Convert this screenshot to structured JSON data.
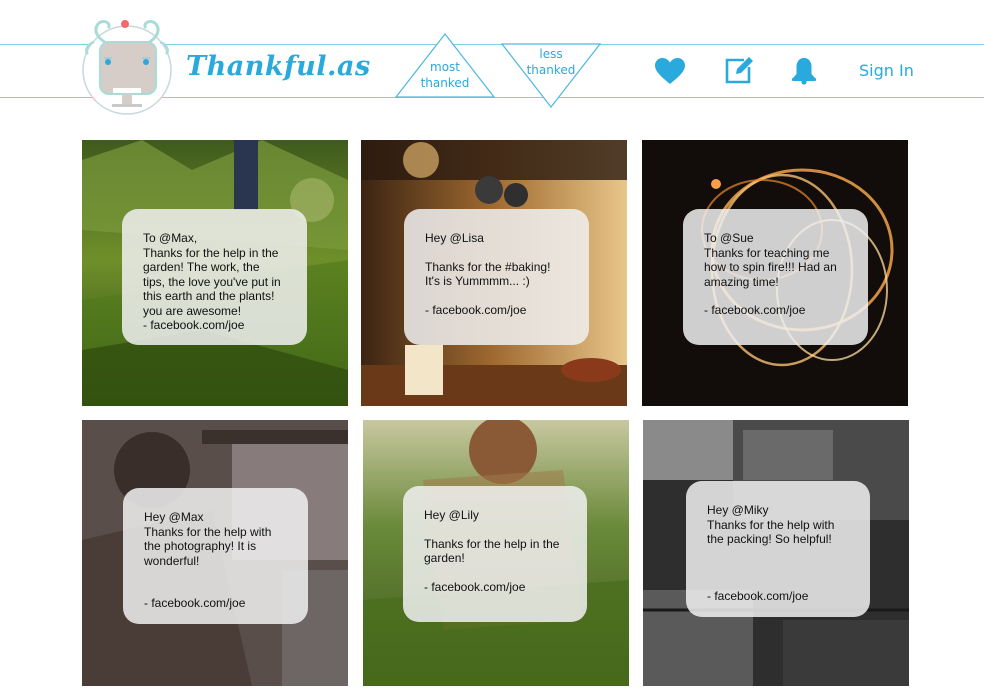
{
  "header": {
    "brand": "Thankful.as",
    "tabs": [
      {
        "line1": "most",
        "line2": "thanked"
      },
      {
        "line1": "less",
        "line2": "thanked"
      }
    ],
    "icons": [
      "heart-icon",
      "edit-icon",
      "bell-icon"
    ],
    "sign_in": "Sign In"
  },
  "colors": {
    "accent": "#29a9dc",
    "card": "#f0f0f0"
  },
  "posts": [
    {
      "to": "To @Max,",
      "lines": [
        "Thanks for the help in the",
        "garden! The work, the",
        "tips, the love you've put in",
        "this earth and the plants!",
        "you are awesome!"
      ],
      "from": "- facebook.com/joe",
      "photo": "green grass with person standing"
    },
    {
      "to": "Hey @Lisa",
      "lines": [
        "Thanks for the #baking!",
        "It's is Yummmm... :)"
      ],
      "from": "- facebook.com/joe",
      "photo": "warm kitchen with hanging pans"
    },
    {
      "to": "To @Sue",
      "lines": [
        "Thanks for teaching me",
        "how to spin fire!!! Had an",
        "amazing time!"
      ],
      "from": "- facebook.com/joe",
      "photo": "fire spinning circles at night"
    },
    {
      "to": "Hey @Max",
      "lines": [
        "Thanks for the help with",
        "the photography! It is",
        "wonderful!"
      ],
      "from": "- facebook.com/joe",
      "photo": "black and white portrait of man"
    },
    {
      "to": "Hey @Lily",
      "lines": [
        "Thanks for the help in the",
        "garden!"
      ],
      "from": "- facebook.com/joe",
      "photo": "person gardening in grass"
    },
    {
      "to": "Hey @Miky",
      "lines": [
        "Thanks for the help with",
        "the packing! So helpful!"
      ],
      "from": "- facebook.com/joe",
      "photo": "black and white wooden crates"
    }
  ]
}
